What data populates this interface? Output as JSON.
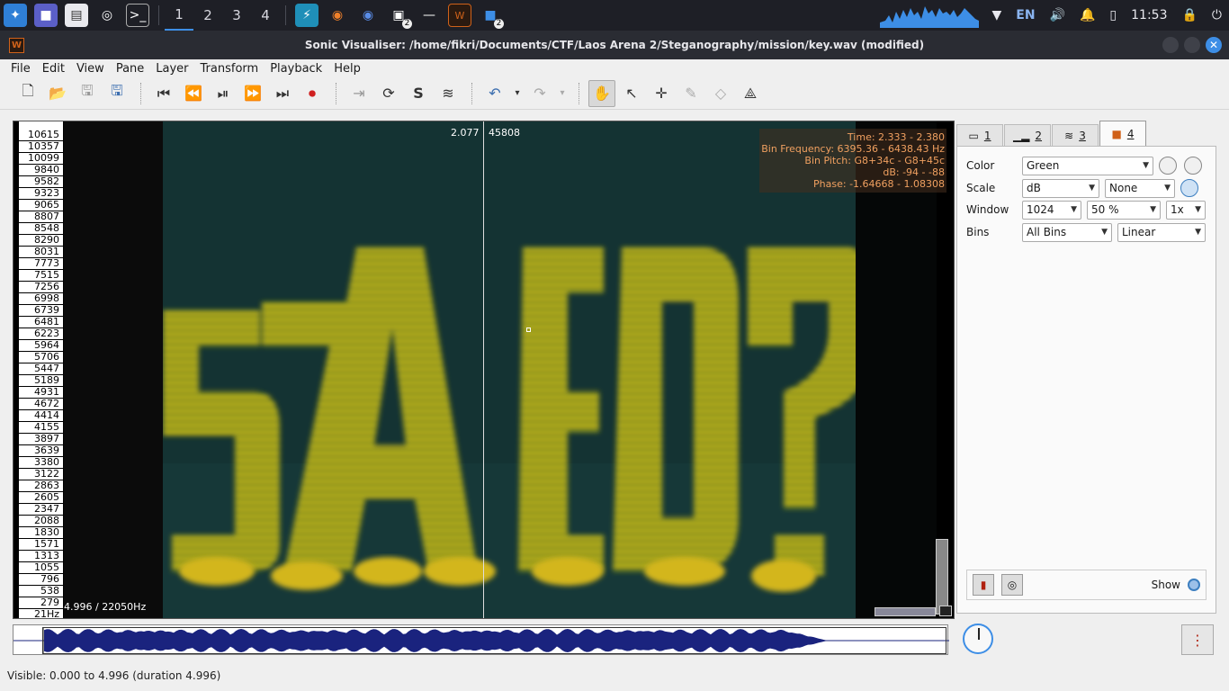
{
  "taskbar": {
    "workspaces": [
      "1",
      "2",
      "3",
      "4"
    ],
    "active_workspace": "1",
    "badge_count": "2",
    "badge_count_2": "2",
    "language": "EN",
    "clock": "11:53"
  },
  "window": {
    "title": "Sonic Visualiser: /home/fikri/Documents/CTF/Laos Arena 2/Steganography/mission/key.wav (modified)"
  },
  "menu": [
    "File",
    "Edit",
    "View",
    "Pane",
    "Layer",
    "Transform",
    "Playback",
    "Help"
  ],
  "spectrogram": {
    "freq_ticks": [
      "10615",
      "10357",
      "10099",
      "9840",
      "9582",
      "9323",
      "9065",
      "8807",
      "8548",
      "8290",
      "8031",
      "7773",
      "7515",
      "7256",
      "6998",
      "6739",
      "6481",
      "6223",
      "5964",
      "5706",
      "5447",
      "5189",
      "4931",
      "4672",
      "4414",
      "4155",
      "3897",
      "3639",
      "3380",
      "3122",
      "2863",
      "2605",
      "2347",
      "2088",
      "1830",
      "1571",
      "1313",
      "1055",
      "796",
      "538",
      "279",
      "21Hz"
    ],
    "scale_info": "4.996 / 22050Hz",
    "playhead_time": "2.077",
    "playhead_frame": "45808",
    "hidden_text": "57AED?",
    "colormap": "green-yellow",
    "info": {
      "time": "Time: 2.333 - 2.380",
      "bin_freq": "Bin Frequency: 6395.36 - 6438.43 Hz",
      "bin_pitch": "Bin Pitch: G8+34c - G8+45c",
      "db": "dB: -94 - -88",
      "phase": "Phase: -1.64668 - 1.08308"
    }
  },
  "tabs": [
    {
      "icon": "pane-icon",
      "label": "1"
    },
    {
      "icon": "waveform-small-icon",
      "label": "2"
    },
    {
      "icon": "waveform-icon",
      "label": "3"
    },
    {
      "icon": "spectrogram-icon",
      "label": "4"
    }
  ],
  "props": {
    "color_label": "Color",
    "color_value": "Green",
    "scale_label": "Scale",
    "scale_value": "dB",
    "scale_norm": "None",
    "window_label": "Window",
    "window_size": "1024",
    "window_overlap": "50 %",
    "window_zoom": "1x",
    "bins_label": "Bins",
    "bins_value": "All Bins",
    "bins_scale": "Linear",
    "show_label": "Show"
  },
  "status": {
    "visible": "Visible: 0.000 to 4.996 (duration 4.996)"
  },
  "colors": {
    "accent": "#3d8ee6",
    "info_text": "#f0a060",
    "spectro_low": "#123434",
    "spectro_high": "#e6d21a"
  }
}
